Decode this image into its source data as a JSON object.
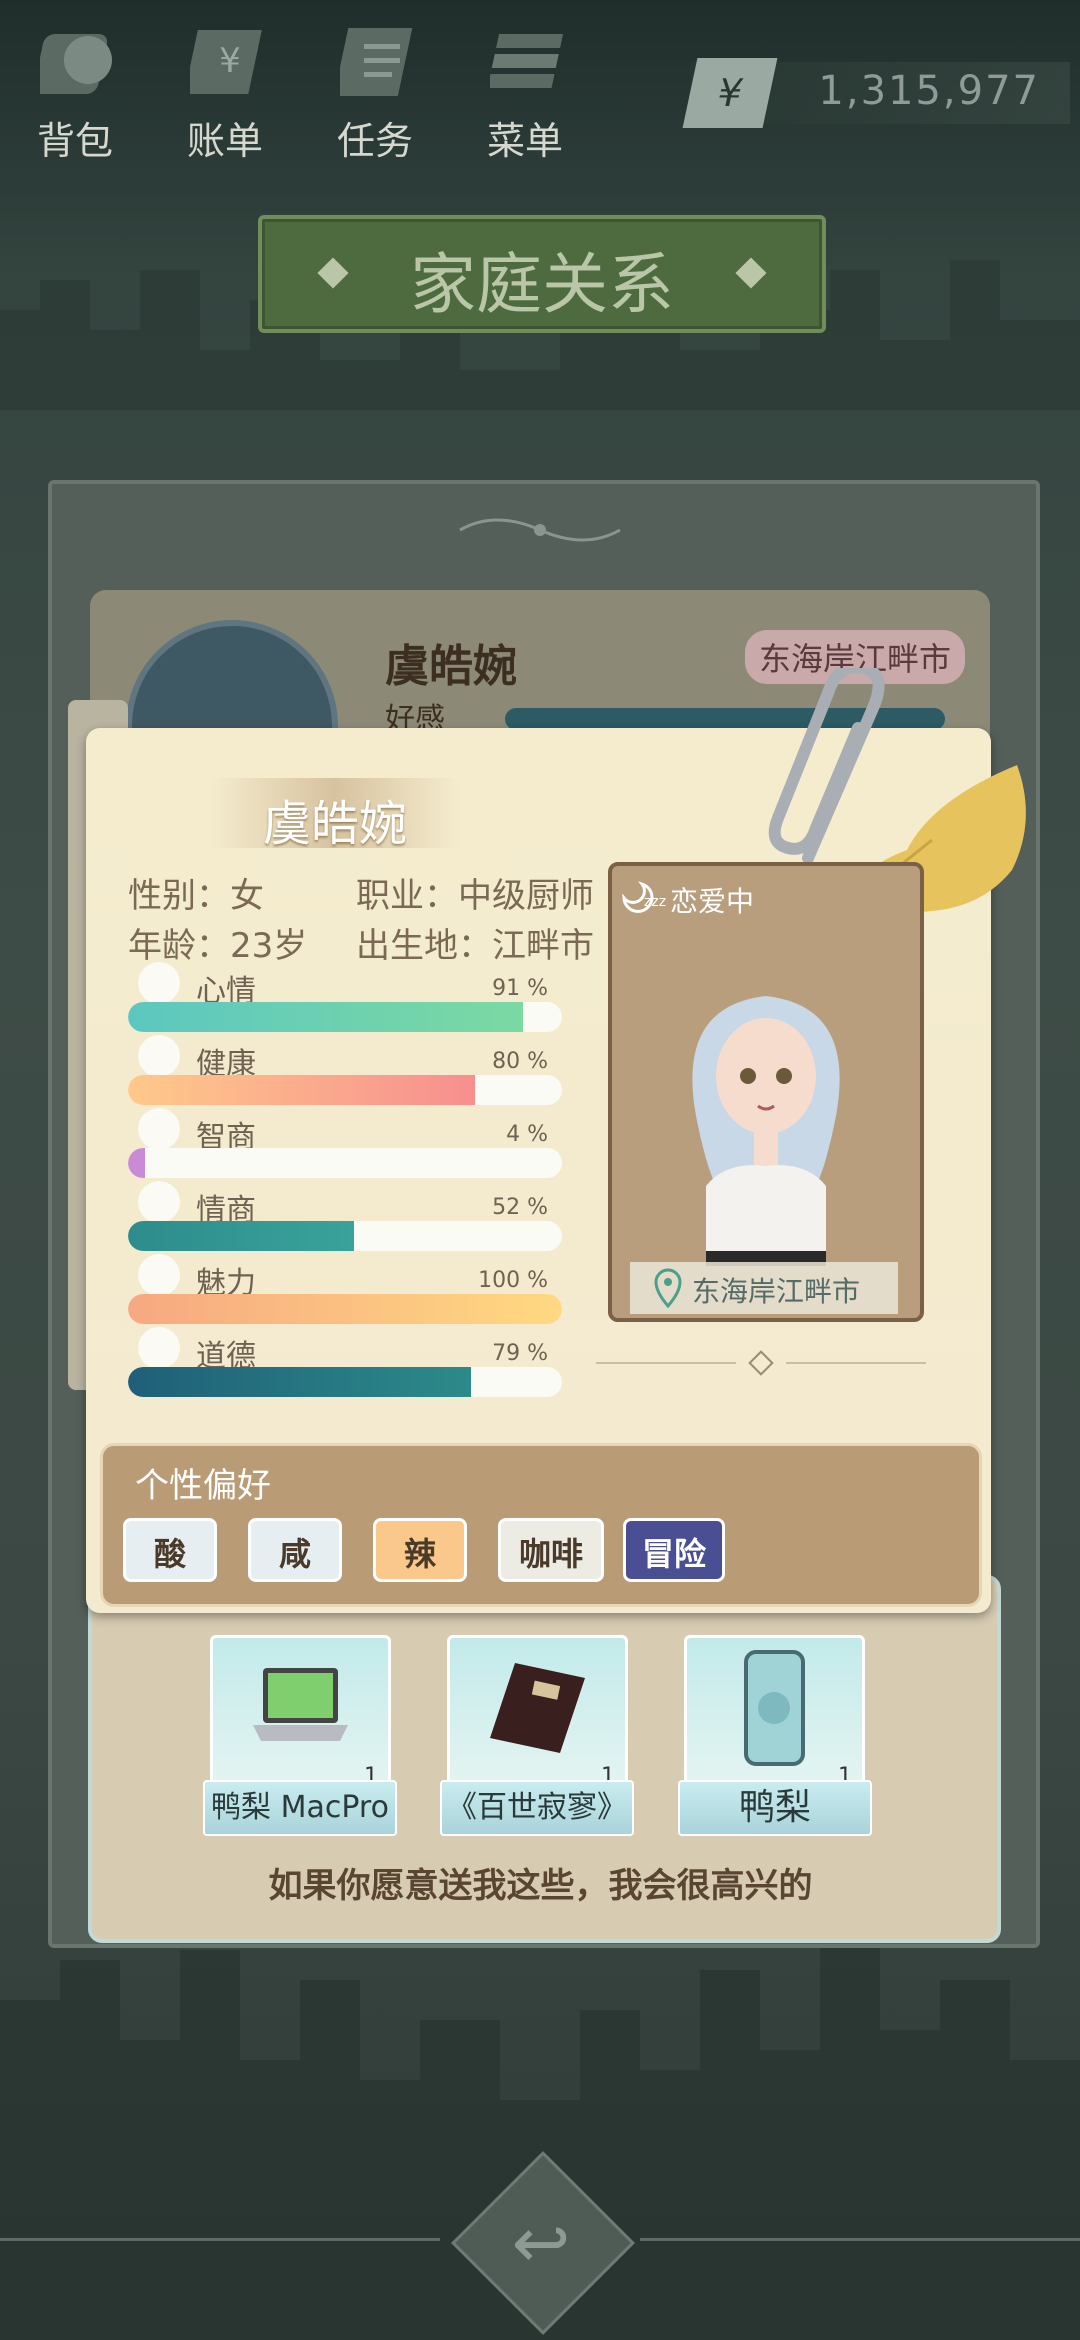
{
  "nav": {
    "items": [
      {
        "label": "背包",
        "icon": "bag-icon"
      },
      {
        "label": "账单",
        "icon": "bill-icon"
      },
      {
        "label": "任务",
        "icon": "task-icon"
      },
      {
        "label": "菜单",
        "icon": "menu-icon"
      }
    ],
    "money_symbol": "¥",
    "money": "1,315,977"
  },
  "title": "家庭关系",
  "back_card": {
    "name": "虞皓婉",
    "location": "东海岸江畔市",
    "partial_label": "好感"
  },
  "profile": {
    "name": "虞皓婉",
    "gender_label": "性别：女",
    "job_label": "职业：中级厨师",
    "age_label": "年龄：23岁",
    "birthplace_label": "出生地：江畔市"
  },
  "stats": [
    {
      "label": "心情",
      "pct_text": "91 %",
      "value": 91,
      "color_from": "#5cc7c0",
      "color_to": "#7bd9a2",
      "icon": "smile-icon"
    },
    {
      "label": "健康",
      "pct_text": "80 %",
      "value": 80,
      "color_from": "#ffc98a",
      "color_to": "#f78f8f",
      "icon": "heart-icon"
    },
    {
      "label": "智商",
      "pct_text": "4 %",
      "value": 4,
      "color_from": "#c98ad6",
      "color_to": "#c98ad6",
      "icon": "bulb-icon"
    },
    {
      "label": "情商",
      "pct_text": "52 %",
      "value": 52,
      "color_from": "#2d8c8c",
      "color_to": "#3aa29a",
      "icon": "apple-icon"
    },
    {
      "label": "魅力",
      "pct_text": "100 %",
      "value": 100,
      "color_from": "#f7a881",
      "color_to": "#ffd981",
      "icon": "sparkle-icon"
    },
    {
      "label": "道德",
      "pct_text": "79 %",
      "value": 79,
      "color_from": "#1f5f78",
      "color_to": "#2c8a8a",
      "icon": "scale-icon"
    }
  ],
  "portrait": {
    "status": "恋爱中",
    "location": "东海岸江畔市"
  },
  "preferences": {
    "title": "个性偏好",
    "items": [
      {
        "label": "酸",
        "color": "#e6eef2"
      },
      {
        "label": "咸",
        "color": "#e6eef2"
      },
      {
        "label": "辣",
        "color": "#f9c88a"
      },
      {
        "label": "咖啡",
        "color": "#ecebe4"
      },
      {
        "label": "冒险",
        "color": "#4a4e93"
      }
    ]
  },
  "gifts": {
    "items": [
      {
        "name": "鸭梨 MacPro",
        "count": "1",
        "icon": "laptop-icon"
      },
      {
        "name": "《百世寂寥》",
        "count": "1",
        "icon": "book-icon"
      },
      {
        "name": "鸭梨",
        "count": "1",
        "icon": "phone-icon"
      }
    ],
    "caption": "如果你愿意送我这些，我会很高兴的"
  }
}
